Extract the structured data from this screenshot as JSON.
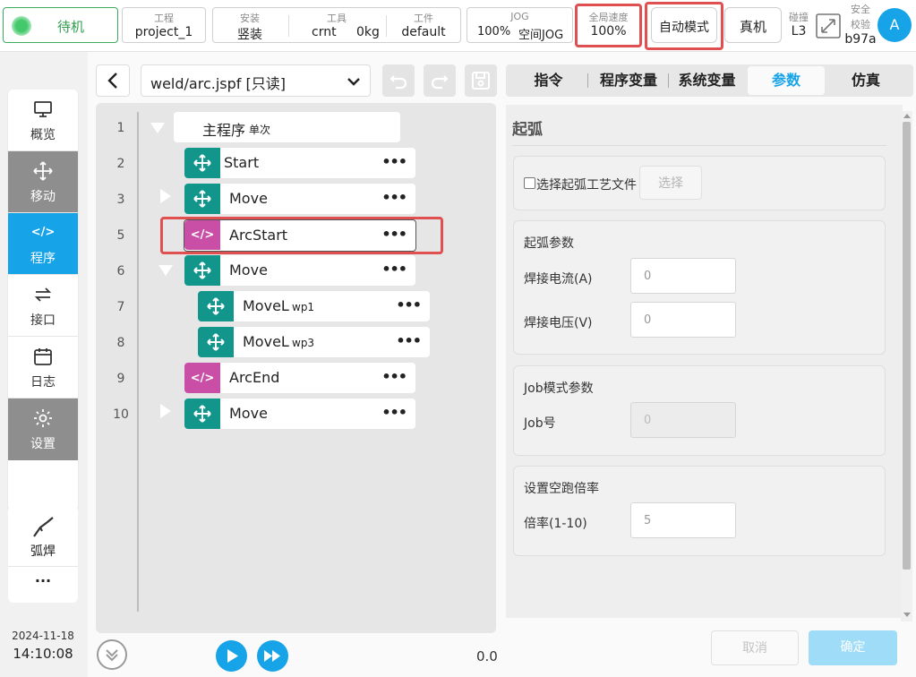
{
  "topbar": {
    "status": "待机",
    "project_label": "工程",
    "project_value": "project_1",
    "install_label": "安装",
    "install_value": "竖装",
    "tool_label": "工具",
    "tool_value": "crnt",
    "tool_weight": "0kg",
    "workpiece_label": "工件",
    "workpiece_value": "default",
    "jog_label": "JOG",
    "jog_speed": "100%",
    "jog_mode": "空间JOG",
    "global_speed_label": "全局速度",
    "global_speed_value": "100%",
    "auto_mode_button": "自动模式",
    "real_robot_button": "真机",
    "collision_label": "碰撞",
    "collision_value": "L3",
    "safety_label_1": "安全",
    "safety_label_2": "校验",
    "safety_value": "b97a",
    "avatar": "A"
  },
  "sidebar": {
    "items": [
      {
        "label": "概览"
      },
      {
        "label": "移动"
      },
      {
        "label": "程序"
      },
      {
        "label": "接口"
      },
      {
        "label": "日志"
      },
      {
        "label": "设置"
      }
    ],
    "arc_weld_label": "弧焊",
    "more_label": "...",
    "date": "2024-11-18",
    "time": "14:10:08"
  },
  "program": {
    "file_path": "weld/arc.jspf [只读]",
    "lines": [
      {
        "num": "1",
        "text": "主程序",
        "sub": "单次"
      },
      {
        "num": "2",
        "text": "Start"
      },
      {
        "num": "3",
        "text": "Move"
      },
      {
        "num": "5",
        "text": "ArcStart"
      },
      {
        "num": "6",
        "text": "Move"
      },
      {
        "num": "7",
        "text": "MoveL",
        "sub": "wp1"
      },
      {
        "num": "8",
        "text": "MoveL",
        "sub": "wp3"
      },
      {
        "num": "9",
        "text": "ArcEnd"
      },
      {
        "num": "10",
        "text": "Move"
      }
    ],
    "progress_value": "0.0"
  },
  "tabs": [
    {
      "label": "指令"
    },
    {
      "label": "程序变量"
    },
    {
      "label": "系统变量"
    },
    {
      "label": "参数"
    },
    {
      "label": "仿真"
    }
  ],
  "params": {
    "title": "起弧",
    "select_file_label": "选择起弧工艺文件",
    "select_button": "选择",
    "arc_params_title": "起弧参数",
    "current_label": "焊接电流(A)",
    "current_value": "0",
    "voltage_label": "焊接电压(V)",
    "voltage_value": "0",
    "job_title": "Job模式参数",
    "job_no_label": "Job号",
    "job_no_value": "0",
    "dry_run_title": "设置空跑倍率",
    "rate_label": "倍率(1-10)",
    "rate_value": "5",
    "cancel_button": "取消",
    "confirm_button": "确定"
  },
  "colors": {
    "teal": "#12968c",
    "magenta": "#c94fa6",
    "active_blue": "#16a3e8",
    "red_highlight": "#e05050"
  }
}
